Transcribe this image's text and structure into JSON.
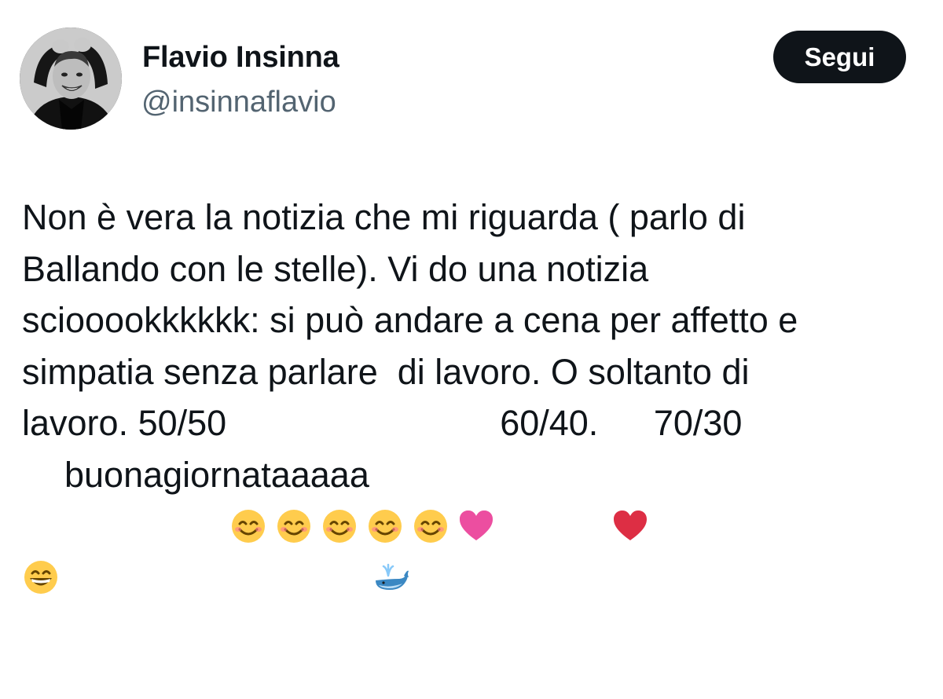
{
  "author": {
    "name": "Flavio Insinna",
    "handle": "@insinnaflavio"
  },
  "follow_button": {
    "label": "Segui"
  },
  "tweet": {
    "lines": [
      {
        "a": "Non è vera la notizia che mi riguarda ( parlo di"
      },
      {
        "a": "Ballando con le stelle). Vi do una notizia"
      },
      {
        "a": "sciooookkkkkk: si può andare a cena per affetto e"
      },
      {
        "a": "simpatia senza parlare  di lavoro. O soltanto di"
      },
      {
        "a": "lavoro. 50/50",
        "b": "60/40. ",
        "c": "70/30"
      },
      {
        "a": "buonagiornataaaaa"
      }
    ],
    "emojis": {
      "line5_group1": [
        "smiling-face-with-smiling-eyes",
        "smiling-face-with-smiling-eyes",
        "smiling-face-with-smiling-eyes",
        "smiling-face-with-smiling-eyes",
        "smiling-face-with-smiling-eyes",
        "pink-heart"
      ],
      "line5_group2": [
        "red-heart"
      ],
      "line6_prefix": [
        "grinning-face-with-smiling-eyes"
      ],
      "line6_suffix": [
        "spouting-whale"
      ]
    }
  },
  "colors": {
    "text": "#0f1419",
    "secondary_text": "#536471",
    "button_bg": "#0f1419",
    "button_text": "#ffffff"
  }
}
